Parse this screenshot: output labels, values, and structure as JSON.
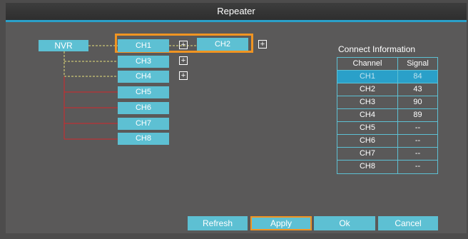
{
  "window": {
    "title": "Repeater"
  },
  "topology": {
    "root": "NVR",
    "channels": [
      "CH1",
      "CH2",
      "CH3",
      "CH4",
      "CH5",
      "CH6",
      "CH7",
      "CH8"
    ],
    "expand_symbol": "+"
  },
  "connect_info": {
    "title": "Connect Information",
    "headers": [
      "Channel",
      "Signal"
    ],
    "rows": [
      {
        "channel": "CH1",
        "signal": "84"
      },
      {
        "channel": "CH2",
        "signal": "43"
      },
      {
        "channel": "CH3",
        "signal": "90"
      },
      {
        "channel": "CH4",
        "signal": "89"
      },
      {
        "channel": "CH5",
        "signal": "--"
      },
      {
        "channel": "CH6",
        "signal": "--"
      },
      {
        "channel": "CH7",
        "signal": "--"
      },
      {
        "channel": "CH8",
        "signal": "--"
      }
    ]
  },
  "buttons": {
    "refresh": "Refresh",
    "apply": "Apply",
    "ok": "Ok",
    "cancel": "Cancel"
  },
  "colors": {
    "node": "#5dc0d3",
    "accent": "#2aa0c9",
    "selection": "#f09422",
    "wireless_link": "#e6e07a",
    "wired_link": "#d4282a",
    "background": "#5a5959"
  }
}
